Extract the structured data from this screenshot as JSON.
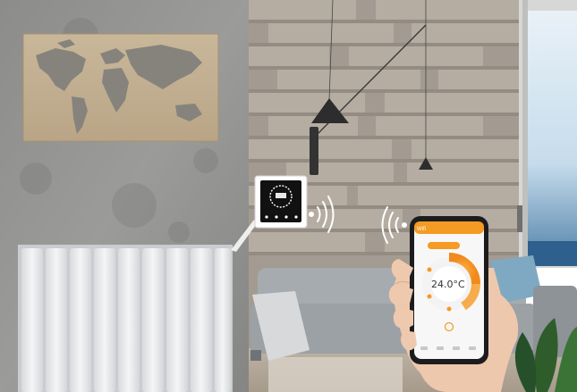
{
  "thermostat": {
    "screen_state": "on"
  },
  "phone": {
    "app_title": "Wifi",
    "mode_button": "",
    "temperature": "24.0°C",
    "accent": "#f59a23",
    "icons": [
      "power-icon",
      "clock-icon",
      "eco-icon",
      "fan-icon",
      "lock-icon",
      "settings-icon"
    ]
  },
  "colors": {
    "concrete": "#8f8f8d",
    "wood_wall": "#a49c92",
    "sofa": "#9aa0a4",
    "radiator": "#ecedef",
    "accent": "#f59a23"
  }
}
